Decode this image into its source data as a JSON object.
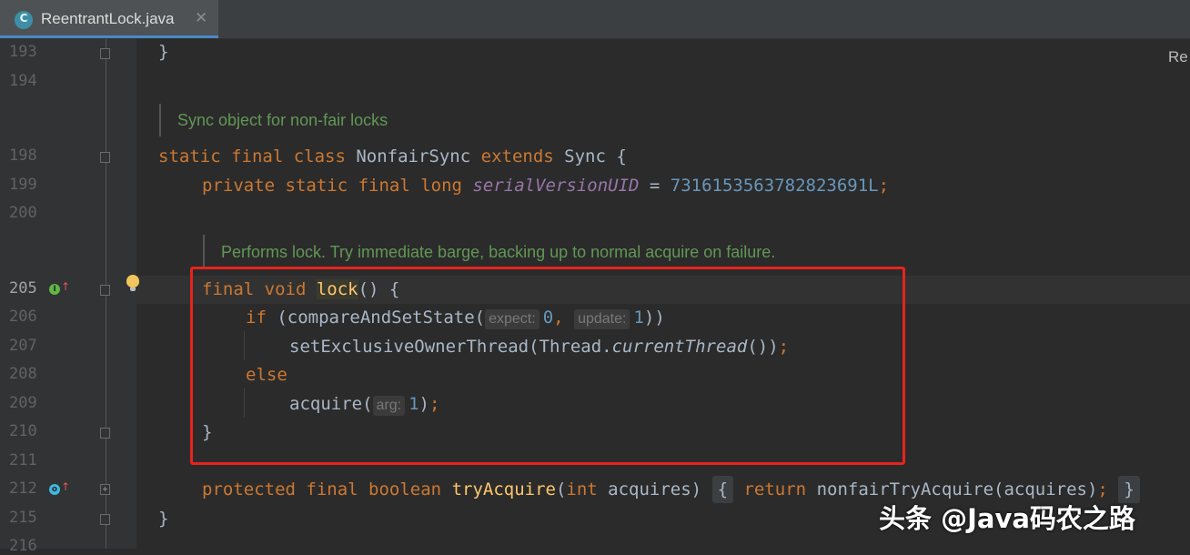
{
  "tab": {
    "title": "ReentrantLock.java",
    "icon_letter": "C",
    "close": "✕"
  },
  "right_label": "Re",
  "gutter": {
    "lines": [
      "193",
      "194",
      "198",
      "199",
      "200",
      "205",
      "206",
      "207",
      "208",
      "209",
      "210",
      "211",
      "212",
      "215",
      "216"
    ]
  },
  "doc": {
    "sync_comment": "Sync object for non-fair locks",
    "lock_comment": "Performs lock. Try immediate barge, backing up to normal acquire on failure."
  },
  "code": {
    "close_brace": "}",
    "static_kw": "static final class",
    "class_name": " NonfairSync ",
    "extends_kw": "extends",
    "sync_open": " Sync {",
    "private_kw": "private static final long",
    "serial_field": "serialVersionUID",
    "equals": " = ",
    "serial_value": "7316153563782823691L",
    "semi": ";",
    "final_void": "final void",
    "lock_name": "lock",
    "lock_rest": "() {",
    "if_kw": "if",
    "cas_call": " (compareAndSetState(",
    "hint_expect": "expect:",
    "zero": "0",
    "comma": ",",
    "hint_update": "update:",
    "one": "1",
    "close_paren2": "))",
    "set_owner": "setExclusiveOwnerThread(Thread.",
    "current_thread": "currentThread",
    "paren_close": "())",
    "else_kw": "else",
    "acquire": "acquire(",
    "hint_arg": "arg:",
    "paren_single": ")",
    "protected_kw": "protected final boolean",
    "try_acquire": "tryAcquire",
    "int_open": "(",
    "int_kw": "int",
    "acquires_param": " acquires) ",
    "open_brace": "{",
    "return_kw": "return",
    "nonfair_call": " nonfairTryAcquire(acquires)",
    "end_brace": "}"
  },
  "watermark": "头条 @Java码农之路",
  "colors": {
    "keyword": "#cc7832",
    "function": "#ffc66d",
    "number": "#6897bb",
    "field": "#9876aa",
    "comment": "#629755",
    "highlight_box": "#e8231d"
  }
}
